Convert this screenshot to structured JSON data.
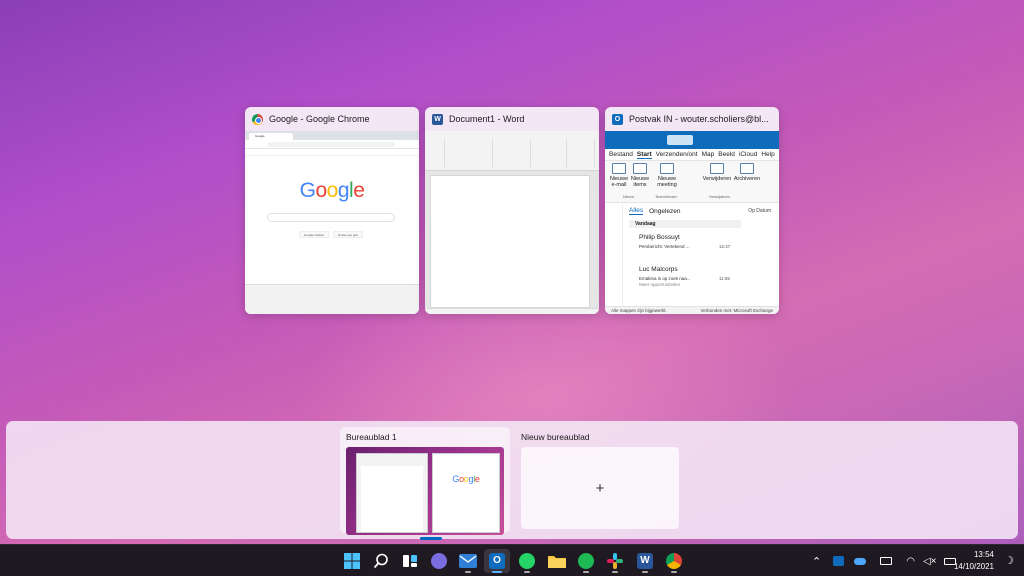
{
  "windows": [
    {
      "title": "Google - Google Chrome",
      "icon": "chrome-icon"
    },
    {
      "title": "Document1 - Word",
      "icon": "word-icon"
    },
    {
      "title": "Postvak IN - wouter.scholiers@bl...",
      "icon": "outlook-icon"
    }
  ],
  "chrome_thumb": {
    "logo": [
      "G",
      "o",
      "o",
      "g",
      "l",
      "e"
    ],
    "buttons": [
      "Google zoeken",
      "Ik doe een gok"
    ]
  },
  "outlook_thumb": {
    "menu": [
      "Bestand",
      "Start",
      "Verzenden/ont",
      "Map",
      "Beeld",
      "iCloud",
      "Help"
    ],
    "ribbon": {
      "new_email": "Nieuwe e-mail",
      "new_items": "Nieuwe items",
      "new_meeting": "Nieuwe meeting",
      "delete": "Verwijderen",
      "archive": "Archiveren",
      "group_new": "Nieuw",
      "group_teamviewer": "TeamViewer",
      "group_delete": "Verwijderen"
    },
    "tabs": {
      "all": "Alles",
      "unread": "Ongelezen",
      "sort": "Op Datum"
    },
    "group_header": "Vandaag",
    "mails": [
      {
        "from": "Philip Bossuyt",
        "subject": "Persbericht: Vertekend ...",
        "preview": "",
        "time": "12:47"
      },
      {
        "from": "Luc Malcorps",
        "subject": "Emakina is op zoek naa...",
        "preview": "Meer opportuniteiten",
        "time": "11:55"
      }
    ],
    "status_left": "Alle mappen zijn bijgewerkt.",
    "status_right": "Verbonden met: Microsoft Exchange"
  },
  "desktops": [
    {
      "label": "Bureaublad 1"
    },
    {
      "label": "Nieuw bureaublad",
      "plus": "+"
    }
  ],
  "taskbar": {
    "apps": [
      "start",
      "search",
      "task-view",
      "teams-chat",
      "mail",
      "outlook",
      "whatsapp",
      "file-explorer",
      "spotify",
      "slack",
      "word",
      "chrome"
    ],
    "colors": {
      "accent": "#0067c0",
      "taskbar_bg": "#1f1a22"
    }
  },
  "tray": {
    "time": "13:54",
    "date": "14/10/2021"
  }
}
